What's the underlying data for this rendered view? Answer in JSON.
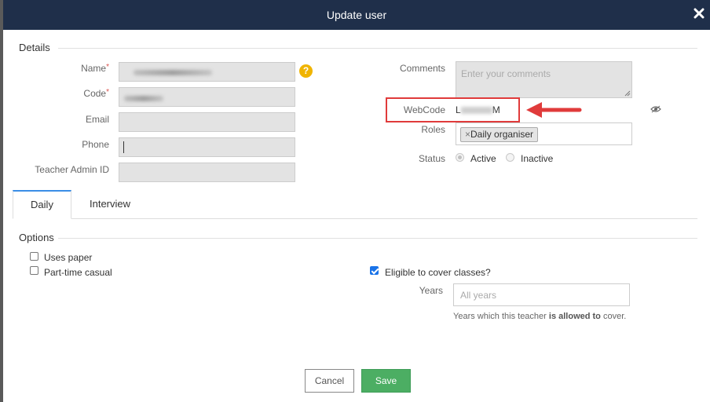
{
  "modal": {
    "title": "Update user",
    "close_icon": "close-icon"
  },
  "details": {
    "legend": "Details",
    "fields": {
      "name_label": "Name",
      "code_label": "Code",
      "email_label": "Email",
      "phone_label": "Phone",
      "teacher_admin_label": "Teacher Admin ID",
      "required_mark": "*",
      "help_icon": "?"
    },
    "comments_label": "Comments",
    "comments_placeholder": "Enter your comments",
    "webcode_label": "WebCode",
    "webcode_value_start": "L",
    "webcode_value_end": "M",
    "roles_label": "Roles",
    "role_tag_remove": "×",
    "role_tag": "Daily organiser",
    "status_label": "Status",
    "status_options": [
      "Active",
      "Inactive"
    ],
    "status_selected": "Active"
  },
  "tabs": [
    {
      "label": "Daily",
      "active": true
    },
    {
      "label": "Interview",
      "active": false
    }
  ],
  "options": {
    "legend": "Options",
    "uses_paper": {
      "label": "Uses paper",
      "checked": false
    },
    "part_time": {
      "label": "Part-time casual",
      "checked": false
    },
    "eligible": {
      "label": "Eligible to cover classes?",
      "checked": true
    },
    "years_label": "Years",
    "years_placeholder": "All years",
    "years_hint_pre": "Years which this teacher ",
    "years_hint_bold": "is allowed to",
    "years_hint_post": " cover."
  },
  "footer": {
    "cancel": "Cancel",
    "save": "Save"
  },
  "colors": {
    "header": "#1f2f4a",
    "save": "#4cae63",
    "highlight": "#e03b3b",
    "help": "#f0b400"
  }
}
